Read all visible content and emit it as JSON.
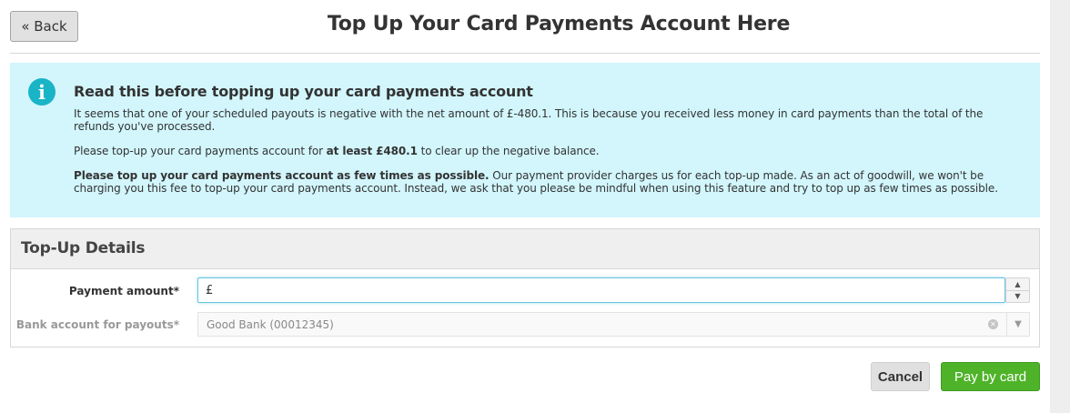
{
  "header": {
    "back_label": "« Back",
    "title": "Top Up Your Card Payments Account Here"
  },
  "info": {
    "icon": "info-icon",
    "heading": "Read this before topping up your card payments account",
    "p1": "It seems that one of your scheduled payouts is negative with the net amount of £-480.1. This is because you received less money in card payments than the total of the refunds you've processed.",
    "p2_pre": "Please top-up your card payments account for ",
    "p2_bold": "at least £480.1",
    "p2_post": " to clear up the negative balance.",
    "p3_bold": "Please top up your card payments account as few times as possible.",
    "p3_rest": " Our payment provider charges us for each top-up made. As an act of goodwill, we won't be charging you this fee to top-up your card payments account. Instead, we ask that you please be mindful when using this feature and try to top up as few times as possible."
  },
  "details": {
    "title": "Top-Up Details",
    "amount_label": "Payment amount*",
    "currency_prefix": "£",
    "amount_value": "",
    "bank_label": "Bank account for payouts*",
    "bank_value": "Good Bank (00012345)"
  },
  "actions": {
    "cancel_label": "Cancel",
    "pay_label": "Pay by card"
  },
  "colors": {
    "info_bg": "#d2f6fc",
    "info_icon": "#1ab4c7",
    "pay_button": "#4fb32a",
    "focus_border": "#66c6e0"
  }
}
